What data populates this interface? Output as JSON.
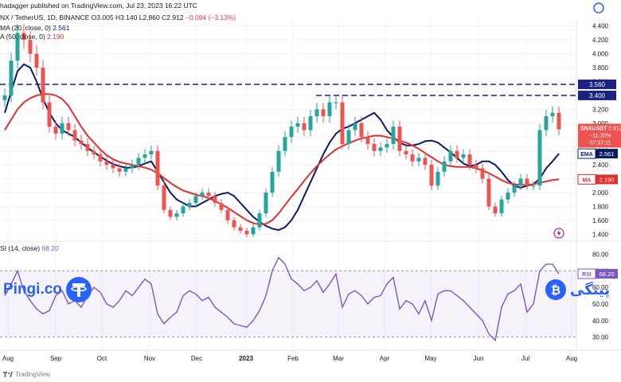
{
  "header": {
    "publisher": "hadagger published on TradingView.com, Jul 23, 2023 16:22 UTC",
    "symbol": "NX / TetherUS, 1D, BINANCE",
    "ohlc": {
      "o_label": "O",
      "o": "3.005",
      "h_label": "H",
      "h": "3.140",
      "l_label": "L",
      "l": "2.860",
      "c_label": "C",
      "c": "2.912",
      "change": "−0.094 (−3.13%)"
    },
    "ema_label": "MA (20, close, 0)",
    "ema_value": "2.561",
    "ma_label": "A (50, close, 0)",
    "ma_value": "2.190"
  },
  "rsi_header": {
    "label": "SI (14, close)",
    "value": "68.20"
  },
  "watermarks": {
    "left": "Pingi.co",
    "right": "پینگی"
  },
  "footer": {
    "brand": "TradingView"
  },
  "colors": {
    "up": "#26a69a",
    "down": "#ef5350",
    "ema": "#0b1c66",
    "ma": "#e0302f",
    "rsi": "#7e57c2",
    "accent": "#2962ff",
    "level": "#1a237e"
  },
  "chart_data": [
    {
      "type": "candlestick",
      "symbol": "SNXUSDT",
      "interval": "1D",
      "ylim": [
        1.3,
        4.5
      ],
      "y_ticks": [
        "4.400",
        "4.200",
        "4.000",
        "3.800",
        "3.600",
        "3.400",
        "3.200",
        "3.000",
        "2.800",
        "2.600",
        "2.400",
        "2.200",
        "2.000",
        "1.800",
        "1.600",
        "1.400"
      ],
      "x_ticks": [
        "Aug",
        "Sep",
        "Oct",
        "Nov",
        "Dec",
        "2023",
        "Feb",
        "Mar",
        "Apr",
        "May",
        "Jun",
        "Jul",
        "Aug"
      ],
      "levels": [
        {
          "label": "3.560",
          "value": 3.56
        },
        {
          "label": "3.400",
          "value": 3.4
        }
      ],
      "price_tag": {
        "label": "SNXUSDT",
        "value": "2.912",
        "change": "−11.35%",
        "timer": "07:37:11"
      },
      "series": [
        {
          "name": "EMA",
          "value_label": "2.561",
          "values": [
            3.15,
            3.45,
            3.75,
            3.85,
            3.8,
            3.6,
            3.35,
            3.15,
            3.0,
            2.9,
            2.85,
            2.8,
            2.72,
            2.65,
            2.58,
            2.52,
            2.46,
            2.41,
            2.38,
            2.36,
            2.36,
            2.38,
            2.42,
            2.45,
            2.3,
            2.15,
            2.0,
            1.9,
            1.85,
            1.8,
            1.8,
            1.85,
            1.9,
            1.95,
            1.98,
            2.0,
            1.95,
            1.85,
            1.75,
            1.65,
            1.58,
            1.52,
            1.48,
            1.46,
            1.5,
            1.6,
            1.75,
            1.95,
            2.15,
            2.35,
            2.55,
            2.72,
            2.85,
            2.92,
            2.95,
            3.0,
            3.05,
            3.1,
            3.15,
            3.05,
            2.9,
            2.8,
            2.72,
            2.68,
            2.68,
            2.7,
            2.74,
            2.75,
            2.72,
            2.65,
            2.58,
            2.5,
            2.42,
            2.38,
            2.4,
            2.45,
            2.45,
            2.4,
            2.3,
            2.18,
            2.1,
            2.07,
            2.1,
            2.12,
            2.2,
            2.35,
            2.45,
            2.561
          ]
        },
        {
          "name": "MA",
          "value_label": "2.190",
          "values": [
            2.9,
            3.05,
            3.2,
            3.3,
            3.36,
            3.4,
            3.42,
            3.42,
            3.4,
            3.35,
            3.25,
            3.1,
            2.95,
            2.82,
            2.72,
            2.62,
            2.54,
            2.48,
            2.44,
            2.42,
            2.4,
            2.38,
            2.36,
            2.33,
            2.28,
            2.21,
            2.14,
            2.08,
            2.03,
            2.0,
            1.97,
            1.95,
            1.92,
            1.88,
            1.83,
            1.78,
            1.72,
            1.66,
            1.6,
            1.56,
            1.54,
            1.55,
            1.6,
            1.7,
            1.82,
            1.94,
            2.05,
            2.17,
            2.28,
            2.38,
            2.47,
            2.55,
            2.62,
            2.67,
            2.71,
            2.75,
            2.78,
            2.8,
            2.82,
            2.82,
            2.8,
            2.78,
            2.75,
            2.72,
            2.68,
            2.63,
            2.57,
            2.51,
            2.45,
            2.4,
            2.38,
            2.37,
            2.37,
            2.37,
            2.35,
            2.32,
            2.28,
            2.23,
            2.18,
            2.14,
            2.12,
            2.11,
            2.11,
            2.12,
            2.14,
            2.16,
            2.18,
            2.19
          ]
        }
      ],
      "candles_close": [
        3.4,
        3.9,
        4.3,
        4.2,
        4.0,
        3.8,
        3.3,
        2.95,
        2.85,
        3.0,
        2.9,
        2.75,
        2.7,
        2.6,
        2.55,
        2.45,
        2.4,
        2.35,
        2.3,
        2.35,
        2.4,
        2.5,
        2.55,
        2.6,
        2.1,
        1.75,
        1.65,
        1.7,
        1.8,
        1.85,
        1.95,
        2.0,
        1.95,
        1.85,
        1.75,
        1.6,
        1.5,
        1.45,
        1.4,
        1.5,
        1.7,
        2.0,
        2.3,
        2.6,
        2.8,
        2.95,
        3.0,
        2.9,
        3.1,
        3.2,
        3.1,
        3.3,
        3.3,
        2.7,
        2.9,
        3.0,
        2.8,
        2.7,
        2.6,
        2.65,
        2.7,
        2.95,
        2.6,
        2.55,
        2.45,
        2.5,
        2.4,
        2.1,
        2.3,
        2.45,
        2.6,
        2.5,
        2.55,
        2.4,
        2.35,
        2.2,
        1.8,
        1.7,
        1.9,
        2.0,
        2.1,
        2.2,
        2.1,
        2.1,
        2.9,
        3.1,
        3.15,
        2.912
      ]
    },
    {
      "type": "line",
      "name": "RSI",
      "ylim": [
        25,
        85
      ],
      "y_ticks": [
        "80.00",
        "70.00",
        "60.00",
        "50.00",
        "40.00",
        "30.00"
      ],
      "bands": [
        70,
        30
      ],
      "value_label": "68.20",
      "values": [
        55,
        62,
        70,
        58,
        52,
        47,
        44,
        46,
        55,
        58,
        50,
        52,
        48,
        55,
        60,
        57,
        50,
        48,
        52,
        58,
        55,
        60,
        65,
        62,
        44,
        38,
        42,
        45,
        55,
        58,
        56,
        52,
        54,
        48,
        45,
        42,
        38,
        37,
        36,
        40,
        46,
        55,
        70,
        78,
        74,
        65,
        62,
        58,
        60,
        64,
        57,
        62,
        68,
        48,
        56,
        58,
        55,
        50,
        54,
        55,
        62,
        66,
        47,
        52,
        50,
        44,
        52,
        40,
        56,
        58,
        58,
        55,
        52,
        48,
        44,
        40,
        32,
        28,
        48,
        56,
        58,
        62,
        45,
        50,
        70,
        74,
        74,
        68.2
      ]
    }
  ]
}
